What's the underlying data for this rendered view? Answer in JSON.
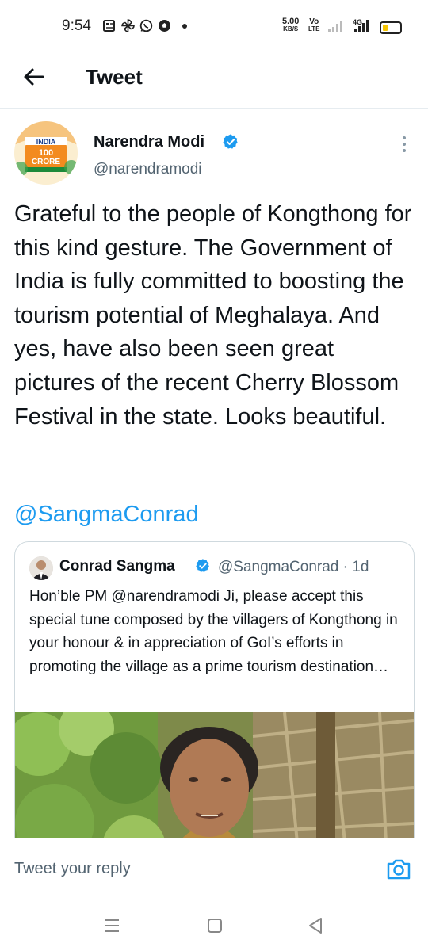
{
  "status_bar": {
    "time": "9:54",
    "net_speed_value": "5.00",
    "net_speed_unit": "KB/S",
    "volte_top": "Vo",
    "volte_bottom": "LTE",
    "network_type": "4G"
  },
  "app_bar": {
    "title": "Tweet"
  },
  "tweet": {
    "author_name": "Narendra Modi",
    "author_handle": "@narendramodi",
    "avatar_text": {
      "line1": "INDIA",
      "line2": "100",
      "line3": "CRORE"
    },
    "text": "Grateful to the people of Kongthong for this kind gesture. The Government of India is fully committed to boosting the tourism potential of Meghalaya. And yes, have also been seen great pictures of the recent Cherry Blossom Festival in the state. Looks beautiful.",
    "mention": "@SangmaConrad"
  },
  "quoted_tweet": {
    "author_name": "Conrad Sangma",
    "author_handle": "@SangmaConrad · 1d",
    "text": "Hon’ble PM @narendramodi Ji, please accept this special tune composed by the villagers of Kongthong in your honour & in appreciation of GoI’s efforts in promoting the village as a prime tourism destination…"
  },
  "reply_bar": {
    "placeholder": "Tweet your reply"
  },
  "colors": {
    "accent": "#1d9bf0",
    "text_primary": "#0f1419",
    "text_secondary": "#536471",
    "border": "#cfd9de"
  },
  "icons": {
    "back": "arrow-left-icon",
    "verified": "verified-badge-icon",
    "more": "more-vertical-icon",
    "camera": "camera-icon",
    "nav_menu": "menu-icon",
    "nav_home": "home-square-icon",
    "nav_back": "back-triangle-icon"
  }
}
